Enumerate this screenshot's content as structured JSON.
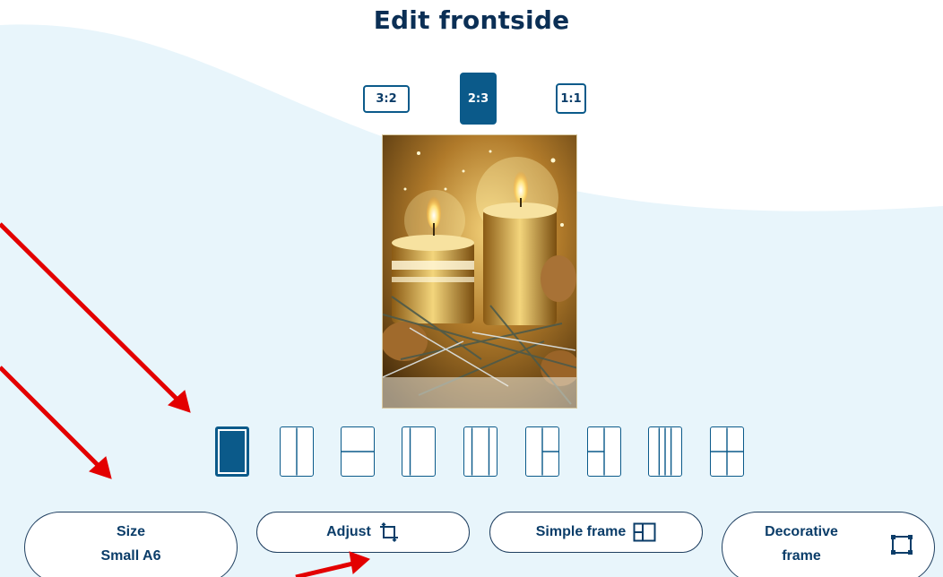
{
  "header": {
    "title": "Edit frontside"
  },
  "ratios": [
    {
      "label": "3:2",
      "active": false
    },
    {
      "label": "2:3",
      "active": true
    },
    {
      "label": "1:1",
      "active": false
    }
  ],
  "photo": {
    "description_icon": "candles-photo"
  },
  "layouts": [
    {
      "name": "single",
      "active": true
    },
    {
      "name": "two-vertical"
    },
    {
      "name": "two-horizontal"
    },
    {
      "name": "left-narrow"
    },
    {
      "name": "two-vertical-equal"
    },
    {
      "name": "left-full-right-split"
    },
    {
      "name": "right-full-left-split"
    },
    {
      "name": "three-vertical"
    },
    {
      "name": "four-grid"
    }
  ],
  "toolbar": {
    "size": {
      "label": "Size",
      "value": "Small A6"
    },
    "adjust": {
      "label": "Adjust",
      "icon": "crop-icon"
    },
    "simple_frame": {
      "label": "Simple frame",
      "icon": "frame-layout-icon"
    },
    "decorative_frame": {
      "label_line1": "Decorative",
      "label_line2": "frame",
      "icon": "decorative-frame-icon"
    }
  },
  "colors": {
    "accent": "#0b5a8a",
    "title": "#0b2f55",
    "wave": "#e9f6fb",
    "annotation_arrow": "#e30000"
  }
}
